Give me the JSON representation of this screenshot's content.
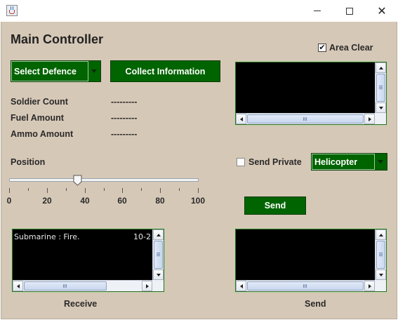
{
  "window": {
    "title": ""
  },
  "header": {
    "title": "Main Controller"
  },
  "defence_combo": {
    "selected": "Select Defence"
  },
  "collect_button": {
    "label": "Collect Information"
  },
  "area_clear": {
    "label": "Area Clear",
    "checked": true
  },
  "stats": [
    {
      "label": "Soldier Count",
      "value": "---------"
    },
    {
      "label": "Fuel Amount",
      "value": "---------"
    },
    {
      "label": "Ammo Amount",
      "value": "---------"
    }
  ],
  "position": {
    "label": "Position",
    "value": 36,
    "min": 0,
    "max": 100,
    "tick_labels": [
      "0",
      "20",
      "40",
      "60",
      "80",
      "100"
    ]
  },
  "send_private": {
    "label": "Send Private",
    "checked": false
  },
  "vehicle_combo": {
    "selected": "Helicopter"
  },
  "send_button": {
    "label": "Send"
  },
  "receive_area": {
    "text": "Submarine : Fire.",
    "overflow_text": "10-2",
    "caption": "Receive"
  },
  "send_area": {
    "text": "",
    "caption": "Send"
  },
  "colors": {
    "panel": "#d6c8b7",
    "accent_green": "#006400",
    "text_area_bg": "#000000"
  },
  "icons": [
    "java-icon",
    "minimize-icon",
    "maximize-icon",
    "close-icon",
    "checkbox-checked-icon",
    "checkbox-empty-icon",
    "combo-arrow-icon",
    "slider-knob-icon"
  ]
}
